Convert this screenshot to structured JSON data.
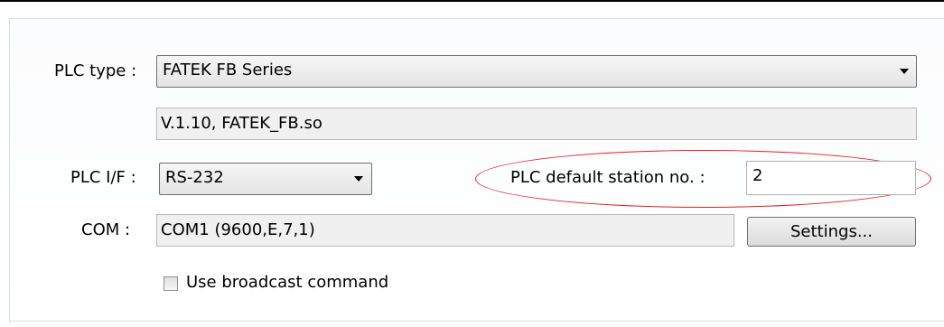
{
  "plc_type": {
    "label": "PLC type :",
    "selected": "FATEK FB Series"
  },
  "driver_info": "V.1.10, FATEK_FB.so",
  "plc_if": {
    "label": "PLC I/F :",
    "selected": "RS-232"
  },
  "station": {
    "label": "PLC default station no. :",
    "value": "2"
  },
  "com": {
    "label": "COM :",
    "value": "COM1 (9600,E,7,1)",
    "settings_button": "Settings..."
  },
  "broadcast": {
    "label": "Use broadcast command",
    "checked": false
  },
  "highlight_color": "#e0202a",
  "icons": [
    "dropdown-arrow-icon",
    "checkbox-icon"
  ]
}
